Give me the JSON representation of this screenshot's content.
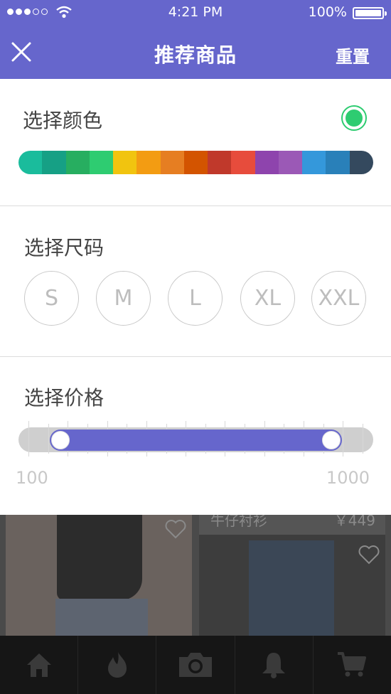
{
  "status_bar": {
    "time": "4:21 PM",
    "battery": "100%",
    "signal_dots": 5,
    "signal_filled": 3
  },
  "header": {
    "title": "推荐商品",
    "reset_label": "重置",
    "background": "#6666cc",
    "close_icon": "close-icon"
  },
  "color_section": {
    "title": "选择颜色",
    "selected_color": "#2ecc71",
    "palette": [
      "#1abc9c",
      "#16a085",
      "#27ae60",
      "#2ecc71",
      "#f1c40f",
      "#f39c12",
      "#e67e22",
      "#d35400",
      "#c0392b",
      "#e74c3c",
      "#8e44ad",
      "#9b59b6",
      "#3498db",
      "#2980b9",
      "#34495e"
    ]
  },
  "size_section": {
    "title": "选择尺码",
    "sizes": [
      "S",
      "M",
      "L",
      "XL",
      "XXL"
    ]
  },
  "price_section": {
    "title": "选择价格",
    "min_label": "100",
    "max_label": "1000",
    "range_fraction": [
      0.0,
      1.0
    ]
  },
  "background_content": {
    "card2_title": "牛仔衬衫",
    "card2_price": "￥449"
  },
  "tab_bar": {
    "items": [
      {
        "icon": "home-icon"
      },
      {
        "icon": "fire-icon"
      },
      {
        "icon": "camera-icon"
      },
      {
        "icon": "bell-icon"
      },
      {
        "icon": "cart-icon"
      }
    ]
  }
}
